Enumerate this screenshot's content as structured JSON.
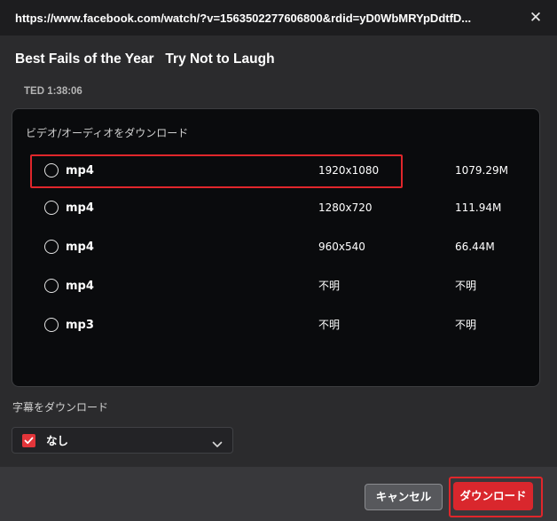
{
  "dialog": {
    "url": "https://www.facebook.com/watch/?v=1563502277606800&rdid=yD0WbMRYpDdtfD...",
    "close_label": "✕",
    "video_title": "Best Fails of the Year   Try Not to Laugh",
    "meta": "TED 1:38:06"
  },
  "download_panel": {
    "title": "ビデオ/オーディオをダウンロード",
    "options": [
      {
        "format": "mp4",
        "resolution": "1920x1080",
        "size": "1079.29M",
        "highlighted": true
      },
      {
        "format": "mp4",
        "resolution": "1280x720",
        "size": "111.94M"
      },
      {
        "format": "mp4",
        "resolution": "960x540",
        "size": "66.44M"
      },
      {
        "format": "mp4",
        "resolution": "不明",
        "size": "不明"
      },
      {
        "format": "mp3",
        "resolution": "不明",
        "size": "不明"
      }
    ]
  },
  "subtitles": {
    "label": "字幕をダウンロード",
    "selected": "なし",
    "checked": true
  },
  "footer": {
    "cancel_label": "キャンセル",
    "download_label": "ダウンロード"
  },
  "colors": {
    "accent": "#d9272d",
    "highlight_outline": "#e0262b",
    "panel_bg": "#0a0b0d",
    "dialog_bg": "#2b2b2d"
  }
}
